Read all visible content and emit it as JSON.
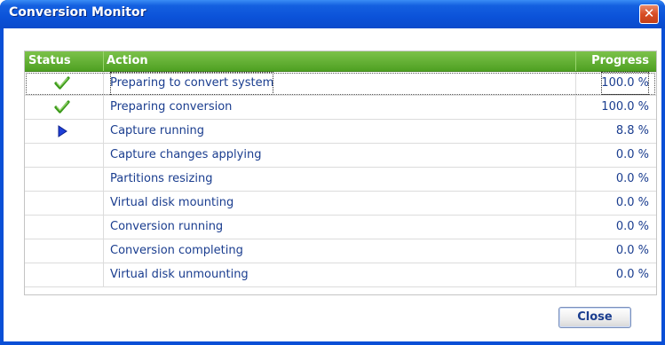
{
  "window": {
    "title": "Conversion Monitor",
    "close_glyph": "✕"
  },
  "grid": {
    "columns": {
      "status": "Status",
      "action": "Action",
      "progress": "Progress"
    },
    "rows": [
      {
        "status": "done-check-icon",
        "action": "Preparing to convert system",
        "progress": "100.0 %",
        "selected": true
      },
      {
        "status": "done-check-icon",
        "action": "Preparing conversion",
        "progress": "100.0 %"
      },
      {
        "status": "running-arrow-icon",
        "action": "Capture running",
        "progress": "8.8 %"
      },
      {
        "status": "",
        "action": "Capture changes applying",
        "progress": "0.0 %"
      },
      {
        "status": "",
        "action": "Partitions resizing",
        "progress": "0.0 %"
      },
      {
        "status": "",
        "action": "Virtual disk mounting",
        "progress": "0.0 %"
      },
      {
        "status": "",
        "action": "Conversion running",
        "progress": "0.0 %"
      },
      {
        "status": "",
        "action": "Conversion completing",
        "progress": "0.0 %"
      },
      {
        "status": "",
        "action": "Virtual disk unmounting",
        "progress": "0.0 %"
      }
    ]
  },
  "footer": {
    "close_label": "Close"
  },
  "colors": {
    "header_green": "#5aad2a",
    "text_blue": "#1a3d8f",
    "check_green": "#3c9a1c",
    "arrow_blue": "#1e3fd8"
  }
}
